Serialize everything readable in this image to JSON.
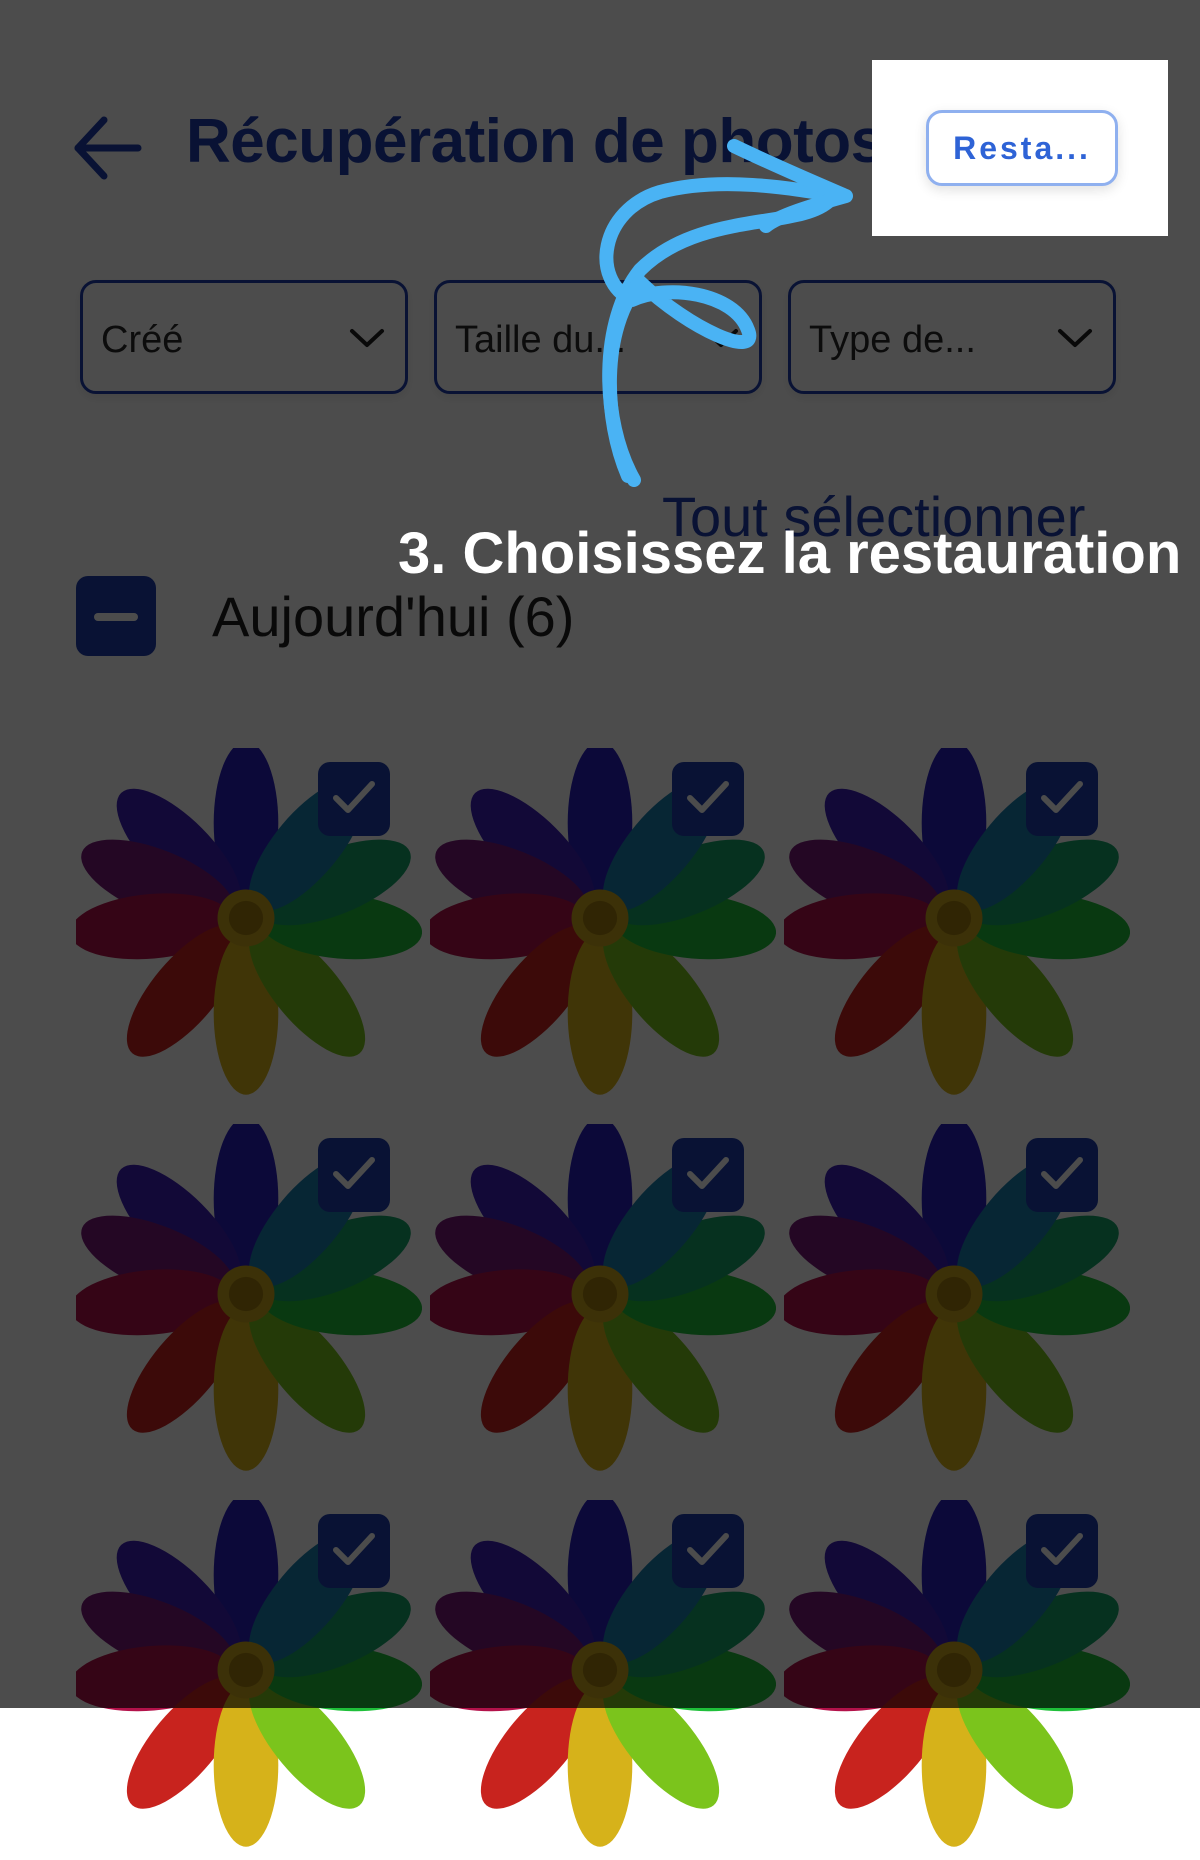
{
  "header": {
    "title": "Récupération de photos",
    "restore_label": "Resta..."
  },
  "filters": [
    {
      "label": "Créé"
    },
    {
      "label": "Taille du..."
    },
    {
      "label": "Type de..."
    }
  ],
  "select_all_label": "Tout sélectionner",
  "section": {
    "title": "Aujourd'hui (6)",
    "state": "partial"
  },
  "photos": [
    {
      "selected": true
    },
    {
      "selected": true
    },
    {
      "selected": true
    },
    {
      "selected": true
    },
    {
      "selected": true
    },
    {
      "selected": true
    },
    {
      "selected": true
    },
    {
      "selected": true
    },
    {
      "selected": true
    }
  ],
  "tutorial": {
    "step_label": "3. Choisissez la restauration",
    "arrow_color": "#4ab3f4"
  },
  "colors": {
    "primary": "#1e3fae",
    "restore_text": "#2e63d6",
    "overlay": "rgba(0,0,0,0.70)"
  }
}
